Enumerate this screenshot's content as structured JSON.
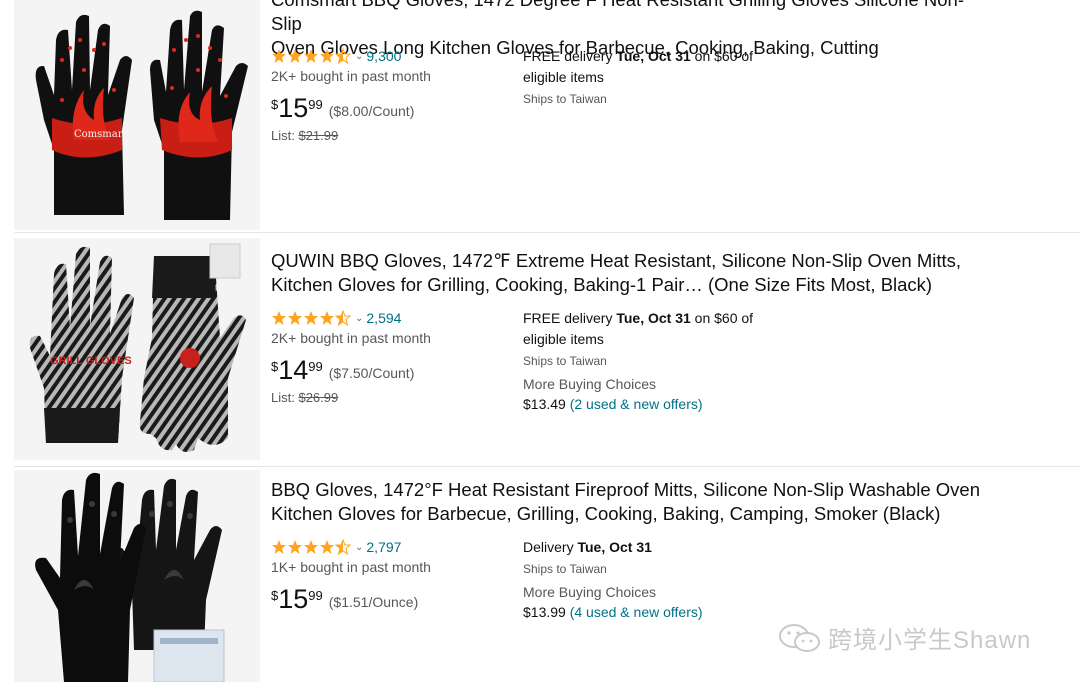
{
  "products": [
    {
      "title": "Comsmart BBQ Gloves, 1472 Degree F Heat Resistant Grilling Gloves Silicone Non-Slip Oven Gloves Long Kitchen Gloves for Barbecue, Cooking, Baking, Cutting",
      "title_line1": "Comsmart BBQ Gloves, 1472 Degree F Heat Resistant Grilling Gloves Silicone Non-Slip",
      "title_line2": "Oven Gloves Long Kitchen Gloves for Barbecue, Cooking, Baking, Cutting",
      "rating_count": "9,300",
      "stars": 4.5,
      "bought": "2K+ bought in past month",
      "price_symbol": "$",
      "price_whole": "15",
      "price_fraction": "99",
      "price_unit": "($8.00/Count)",
      "list_label": "List: ",
      "list_price": "$21.99",
      "delivery_prefix": "FREE delivery ",
      "delivery_date": "Tue, Oct 31",
      "delivery_suffix": " on $60 of eligible items",
      "ships_to": "Ships to Taiwan",
      "image_brand_text": "Comsmart",
      "image_icon": "red-black-bbq-gloves-image"
    },
    {
      "title_line1": "QUWIN BBQ Gloves, 1472℉ Extreme Heat Resistant, Silicone Non-Slip Oven Mitts,",
      "title_line2": "Kitchen Gloves for Grilling, Cooking, Baking-1 Pair… (One Size Fits Most, Black)",
      "rating_count": "2,594",
      "stars": 4.5,
      "bought": "2K+ bought in past month",
      "price_symbol": "$",
      "price_whole": "14",
      "price_fraction": "99",
      "price_unit": "($7.50/Count)",
      "list_label": "List: ",
      "list_price": "$26.99",
      "delivery_prefix": "FREE delivery ",
      "delivery_date": "Tue, Oct 31",
      "delivery_suffix": " on $60 of eligible items",
      "ships_to": "Ships to Taiwan",
      "more_buying": "More Buying Choices",
      "offer_price": "$13.49",
      "offer_link": "(2 used & new offers)",
      "image_brand_text": "GRILL GLOVES",
      "image_icon": "gray-striped-bbq-gloves-image"
    },
    {
      "title_line1": "BBQ Gloves, 1472°F Heat Resistant Fireproof Mitts, Silicone Non-Slip Washable Oven",
      "title_line2": "Kitchen Gloves for Barbecue, Grilling, Cooking, Baking, Camping, Smoker (Black)",
      "rating_count": "2,797",
      "stars": 4.5,
      "bought": "1K+ bought in past month",
      "price_symbol": "$",
      "price_whole": "15",
      "price_fraction": "99",
      "price_unit": "($1.51/Ounce)",
      "delivery_prefix": "Delivery ",
      "delivery_date": "Tue, Oct 31",
      "ships_to": "Ships to Taiwan",
      "more_buying": "More Buying Choices",
      "offer_price": "$13.99",
      "offer_link": "(4 used & new offers)",
      "image_icon": "black-bbq-gloves-image"
    }
  ],
  "colors": {
    "star": "#ffa41c",
    "link": "#007185",
    "muted": "#565959",
    "text": "#0f1111"
  },
  "watermark": {
    "text": "跨境小学生Shawn",
    "icon": "wechat-icon"
  }
}
